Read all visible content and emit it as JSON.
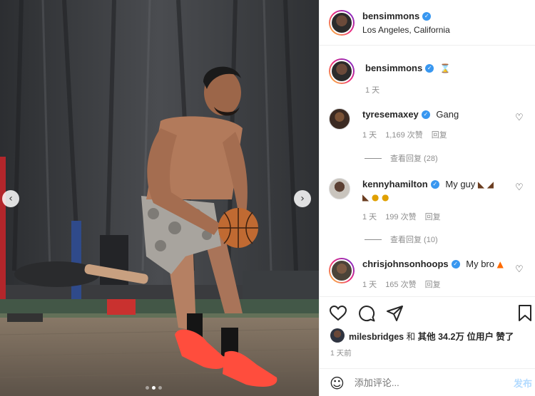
{
  "post_author": {
    "username": "bensimmons",
    "location": "Los Angeles, California",
    "verified": true
  },
  "caption": {
    "username": "bensimmons",
    "text_icon": "hourglass-emoji",
    "time": "1 天"
  },
  "comments": [
    {
      "username": "tyresemaxey",
      "text": "Gang",
      "time": "1 天",
      "likes": "1,169 次赞",
      "reply_label": "回复",
      "view_replies": "查看回复 (28)"
    },
    {
      "username": "kennyhamilton",
      "text": "My guy",
      "text_icons": [
        "flexed-biceps-emoji",
        "flexed-biceps-emoji",
        "flexed-biceps-emoji",
        "fearful-face-emoji",
        "fearful-face-emoji"
      ],
      "time": "1 天",
      "likes": "199 次赞",
      "reply_label": "回复",
      "view_replies": "查看回复 (10)"
    },
    {
      "username": "chrisjohnsonhoops",
      "text": "My bro",
      "text_icon": "fire-emoji",
      "time": "1 天",
      "likes": "165 次赞",
      "reply_label": "回复"
    }
  ],
  "likes_summary": {
    "username": "milesbridges",
    "text_and": "和",
    "text_others": "其他",
    "count": "34.2万",
    "text_users_liked": "位用户 赞了"
  },
  "post_time": "1 天前",
  "add_comment": {
    "placeholder": "添加评论...",
    "post_label": "发布"
  },
  "carousel": {
    "slide_count": 3,
    "active_index": 1
  },
  "colors": {
    "accent": "#3897f0",
    "text": "#262626",
    "muted": "#8e8e8e",
    "post_button_disabled": "#b3dbff",
    "shoes": "#ff4d3d"
  }
}
